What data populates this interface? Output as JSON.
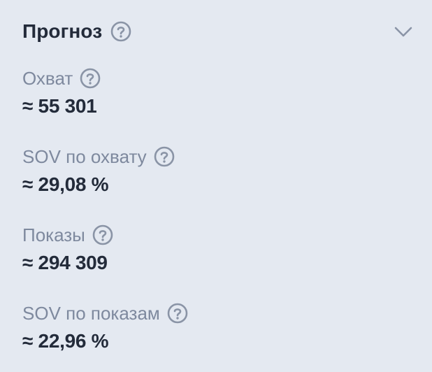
{
  "forecast": {
    "title": "Прогноз",
    "metrics": [
      {
        "label": "Охват",
        "value": "≈ 55 301"
      },
      {
        "label": "SOV по охвату",
        "value": "≈ 29,08 %"
      },
      {
        "label": "Показы",
        "value": "≈ 294 309"
      },
      {
        "label": "SOV по показам",
        "value": "≈ 22,96 %"
      }
    ]
  },
  "icons": {
    "help": "question-circle-icon",
    "collapse": "chevron-down-icon"
  },
  "colors": {
    "background": "#e4e9f1",
    "title": "#232b3a",
    "label": "#7e899e",
    "icon": "#8a94a6"
  }
}
